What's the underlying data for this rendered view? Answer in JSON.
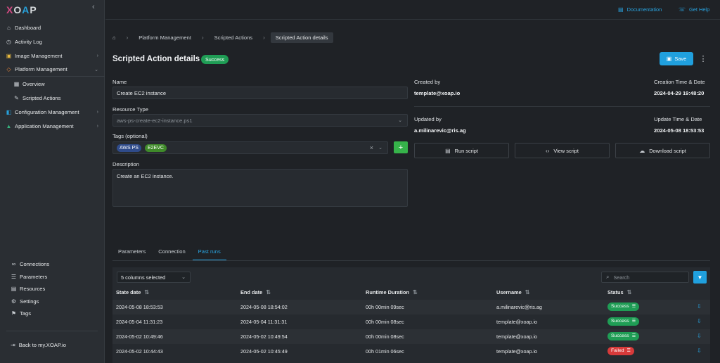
{
  "app": {
    "logo": "XOAP"
  },
  "sidebar": {
    "items": [
      {
        "label": "Dashboard",
        "icon": "home-icon"
      },
      {
        "label": "Activity Log",
        "icon": "clock-icon"
      },
      {
        "label": "Image Management",
        "icon": "image-icon"
      },
      {
        "label": "Platform Management",
        "icon": "platform-icon"
      },
      {
        "label": "Overview",
        "icon": "grid-icon"
      },
      {
        "label": "Scripted Actions",
        "icon": "pencil-icon"
      },
      {
        "label": "Configuration Management",
        "icon": "config-icon"
      },
      {
        "label": "Application Management",
        "icon": "app-icon"
      }
    ],
    "bottom": [
      {
        "label": "Connections",
        "icon": "link-icon"
      },
      {
        "label": "Parameters",
        "icon": "parameters-icon"
      },
      {
        "label": "Resources",
        "icon": "resources-icon"
      },
      {
        "label": "Settings",
        "icon": "gear-icon"
      },
      {
        "label": "Tags",
        "icon": "bookmark-icon"
      }
    ],
    "back": "Back to my.XOAP.io"
  },
  "topbar": {
    "documentation": "Documentation",
    "help": "Get Help"
  },
  "breadcrumb": [
    "Platform Management",
    "Scripted Actions",
    "Scripted Action details"
  ],
  "page": {
    "title": "Scripted Action details",
    "status": "Success",
    "save": "Save"
  },
  "form": {
    "name_label": "Name",
    "name_value": "Create EC2 instance",
    "resource_label": "Resource Type",
    "resource_value": "aws-ps-create-ec2-instance.ps1",
    "tags_label": "Tags (optional)",
    "tags": [
      "AWS PS",
      "E2EVC"
    ],
    "description_label": "Description",
    "description_value": "Create an EC2 instance."
  },
  "meta": {
    "created_by_label": "Created by",
    "created_by": "template@xoap.io",
    "creation_label": "Creation Time & Date",
    "creation": "2024-04-29 19:48:20",
    "updated_by_label": "Updated by",
    "updated_by": "a.milinarevic@ris.ag",
    "update_label": "Update Time & Date",
    "update": "2024-05-08 18:53:53"
  },
  "actions": {
    "run": "Run script",
    "view": "View script",
    "download": "Download script"
  },
  "tabs": [
    "Parameters",
    "Connection",
    "Past runs"
  ],
  "table": {
    "columns_selected": "5 columns selected",
    "search_placeholder": "Search",
    "headers": [
      "State date",
      "End date",
      "Runtime Duration",
      "Username",
      "Status"
    ],
    "rows": [
      {
        "start": "2024-05-08 18:53:53",
        "end": "2024-05-08 18:54:02",
        "duration": "00h 00min 09sec",
        "user": "a.milinarevic@ris.ag",
        "status": "Success"
      },
      {
        "start": "2024-05-04 11:31:23",
        "end": "2024-05-04 11:31:31",
        "duration": "00h 00min 08sec",
        "user": "template@xoap.io",
        "status": "Success"
      },
      {
        "start": "2024-05-02 10:49:46",
        "end": "2024-05-02 10:49:54",
        "duration": "00h 00min 08sec",
        "user": "template@xoap.io",
        "status": "Success"
      },
      {
        "start": "2024-05-02 10:44:43",
        "end": "2024-05-02 10:45:49",
        "duration": "00h 01min 06sec",
        "user": "template@xoap.io",
        "status": "Failed"
      }
    ]
  },
  "colors": {
    "accent": "#20a0de",
    "success": "#1f9d55",
    "failed": "#d73a3a",
    "tag_green": "#36b34a"
  }
}
